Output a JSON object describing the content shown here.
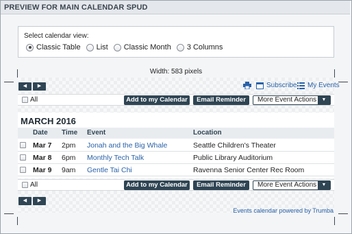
{
  "title": "PREVIEW FOR MAIN CALENDAR SPUD",
  "view_selector": {
    "label": "Select calendar view:",
    "options": [
      {
        "label": "Classic Table",
        "selected": true
      },
      {
        "label": "List",
        "selected": false
      },
      {
        "label": "Classic Month",
        "selected": false
      },
      {
        "label": "3 Columns",
        "selected": false
      }
    ]
  },
  "width_label": "Width: 583 pixels",
  "nav": {
    "prev_icon": "chevron-left-icon",
    "next_icon": "chevron-right-icon",
    "prev_glyph": "◀",
    "next_glyph": "▶"
  },
  "top_links": {
    "subscribe": "Subscribe",
    "my_events": "My Events",
    "print_icon": "printer-icon"
  },
  "actions": {
    "all_label": "All",
    "add_label": "Add to my Calendar",
    "email_label": "Email Reminder",
    "more_label": "More Event Actions",
    "more_arrow": "▼"
  },
  "calendar": {
    "month": "MARCH 2016",
    "columns": {
      "date": "Date",
      "time": "Time",
      "event": "Event",
      "location": "Location"
    },
    "events": [
      {
        "date": "Mar 7",
        "time": "2pm",
        "event": "Jonah and the Big Whale",
        "location": "Seattle Children's Theater"
      },
      {
        "date": "Mar 8",
        "time": "6pm",
        "event": "Monthly Tech Talk",
        "location": "Public Library Auditorium"
      },
      {
        "date": "Mar 9",
        "time": "9am",
        "event": "Gentle Tai Chi",
        "location": "Ravenna Senior Center Rec Room"
      }
    ]
  },
  "footer": "Events calendar powered by Trumba",
  "colors": {
    "accent": "#2a62a8",
    "button": "#2f4554",
    "frame": "#f4f5f7"
  }
}
